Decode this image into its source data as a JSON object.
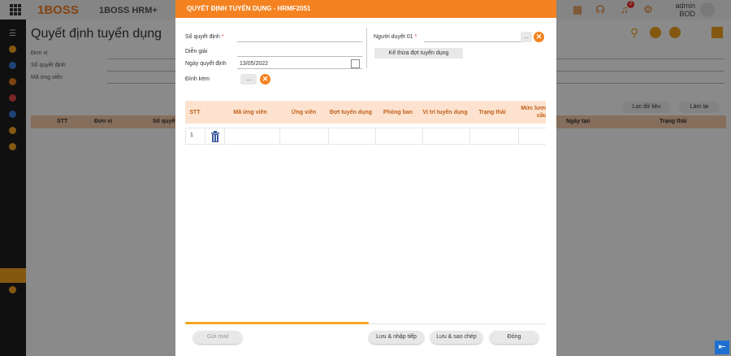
{
  "app": {
    "logo": "1BOSS",
    "title": "1BOSS HRM+",
    "user": "admin",
    "role": "BOD",
    "notification_count": "2"
  },
  "background": {
    "page_title": "Quyết định tuyển dụng",
    "filters": [
      "Đơn vị",
      "Số quyết định",
      "Mã ứng viên"
    ],
    "filter_button": "Lọc dữ liệu",
    "reset_button": "Làm lại",
    "columns": [
      "STT",
      "Đơn vị",
      "Số quyết",
      "Ngày tạo",
      "Trạng thái"
    ]
  },
  "modal": {
    "title": "QUYẾT ĐỊNH TUYỂN DỤNG - HRMF2051",
    "form": {
      "decision_no_label": "Số quyết định",
      "description_label": "Diễn giải",
      "decision_date_label": "Ngày quyết định",
      "decision_date_value": "13/05/2022",
      "attachment_label": "Đính kèm",
      "attachment_button": "...",
      "approver_label": "Người duyệt 01",
      "approver_button": "...",
      "inherit_button": "Kế thừa đợt tuyển dụng"
    },
    "table": {
      "headers": [
        "STT",
        "Mã ứng viên",
        "Ứng viên",
        "Đợt tuyển dụng",
        "Phòng ban",
        "Vị trí tuyển dụng",
        "Trạng thái",
        "Mức lương yêu cầu"
      ],
      "rows": [
        {
          "stt": "1"
        }
      ]
    },
    "footer": {
      "send_mail": "Gửi mail",
      "save_new": "Lưu & nhập tiếp",
      "save_copy": "Lưu & sao chép",
      "close": "Đóng"
    }
  },
  "colors": {
    "accent": "#f58220",
    "header_bg": "#fde3cf",
    "sidebar": "#1e1e1e"
  }
}
